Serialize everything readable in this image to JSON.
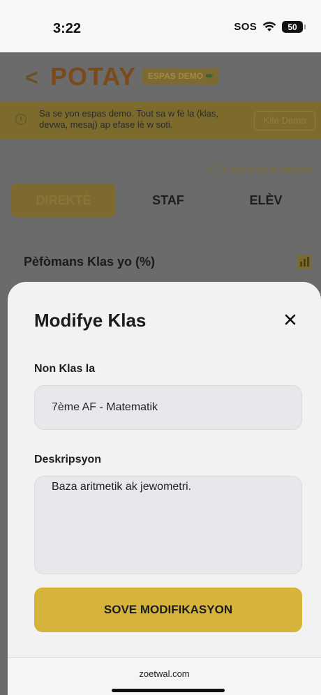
{
  "status_bar": {
    "time": "3:22",
    "sos": "SOS",
    "battery": "50"
  },
  "app": {
    "back_symbol": "<",
    "logo": "POTAY",
    "demo_badge": "ESPAS DEMO",
    "banner": {
      "text": "Sa se yon espas demo. Tout sa w fè la (klas, devwa, mesaj) ap efase lè w soti.",
      "exit_button": "Kite Demo"
    },
    "add_institution": "+ Ajoute lòt enstitisyon",
    "tabs": [
      {
        "label": "DIREKTÈ",
        "active": true
      },
      {
        "label": "STAF",
        "active": false
      },
      {
        "label": "ELÈV",
        "active": false
      }
    ],
    "section_title": "Pèfòmans Klas yo (%)"
  },
  "sheet": {
    "title": "Modifye Klas",
    "name_label": "Non Klas la",
    "name_value": "7ème AF - Matematik",
    "description_label": "Deskripsyon",
    "description_value": "Baza aritmetik ak jewometri.",
    "save_label": "SOVE MODIFIKASYON"
  },
  "footer": {
    "url": "zoetwal.com"
  },
  "colors": {
    "accent": "#d6b33a",
    "overlay": "#6b6b6b",
    "sheet_bg": "#f2f2f2"
  }
}
